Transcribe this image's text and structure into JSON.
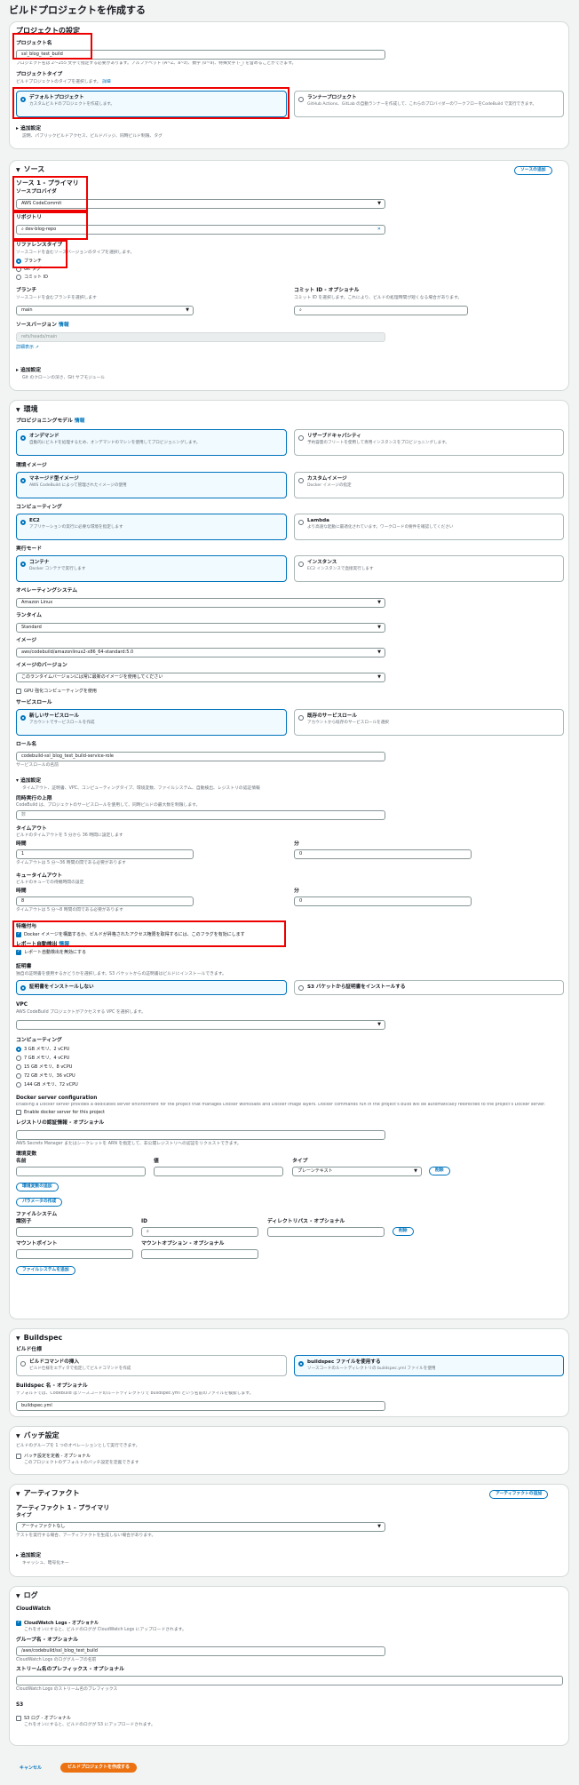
{
  "title": "ビルドプロジェクトを作成する",
  "config": {
    "heading": "プロジェクトの設定",
    "name_label": "プロジェクト名",
    "name_value": "ssl_blog_test_build",
    "name_desc": "プロジェクト名は 2～255 文字で指定する必要があります。アルファベット (A~Z、a~z)、数字 (0~9)、特殊文字 (-_) を含めることができます。",
    "type_label": "プロジェクトタイプ",
    "type_desc": "ビルドプロジェクトのタイプを選択します。",
    "type_more": "詳細",
    "tile1_t": "デフォルトプロジェクト",
    "tile1_d": "カスタムビルドのプロジェクトを作成します。",
    "tile2_t": "ランナープロジェクト",
    "tile2_d": "GitHub Actions、GitLab の自動ランナーを作成して、これらのプロバイダーのワークフローをCodeBuild で実行できます。",
    "additional": "追加設定",
    "additional_desc": "説明、パブリックビルドアクセス、ビルドバッジ、同時ビルド制限、タグ"
  },
  "source": {
    "heading": "ソース",
    "add_btn": "ソースの追加",
    "sub": "ソース 1 - プライマリ",
    "provider_label": "ソースプロバイダ",
    "provider": "AWS CodeCommit",
    "repo_label": "リポジトリ",
    "repo": "dev-blog-repo",
    "ref_label": "リファレンスタイプ",
    "ref_desc": "ソースコードを含むソースバージョンのタイプを選択します。",
    "opt1": "ブランチ",
    "opt2": "Git タグ",
    "opt3": "コミット ID",
    "branch_label": "ブランチ",
    "branch_desc": "ソースコードを含むブランチを選択します",
    "branch": "main",
    "commit_label": "コミット ID - オプショナル",
    "commit_desc": "コミット ID を選択します。これにより、ビルドの処理時間が短くなる場合があります。",
    "ver_label": "ソースバージョン",
    "ver_more": "情報",
    "ver_value": "refs/heads/main",
    "ver_link": "詳細表示 ↗",
    "more": "追加設定",
    "more_desc": "Git のクローンの深さ、Git サブモジュール"
  },
  "env": {
    "heading": "環境",
    "prov_label": "プロビジョニングモデル",
    "prov_more": "情報",
    "t_ondemand": "オンデマンド",
    "t_ondemand_d": "自動的にビルドを処理するため、オンデマンドのマシンを使用してプロビジョニングします。",
    "t_fleet": "リザーブドキャパシティ",
    "t_fleet_d": "予約容量のフリートを使用して専用インスタンスをプロビジョニングします。",
    "img_label": "環境イメージ",
    "t_managed": "マネージド型イメージ",
    "t_managed_d": "AWS CodeBuild によって管理されたイメージの使用",
    "t_custom": "カスタムイメージ",
    "t_custom_d": "Docker イメージの指定",
    "comp_label": "コンピューティング",
    "t_ec2": "EC2",
    "t_ec2_d": "アプリケーションの実行に必要な環境を指定します",
    "t_lambda": "Lambda",
    "t_lambda_d": "より高速な起動に最適化されています。ワークロードの要件を確認してください",
    "run_label": "実行モード",
    "t_container": "コンテナ",
    "t_container_d": "Docker コンテナで実行します",
    "t_instance": "インスタンス",
    "t_instance_d": "EC2 インスタンスで直接実行します",
    "os_label": "オペレーティングシステム",
    "os": "Amazon Linux",
    "rt_label": "ランタイム",
    "rt": "Standard",
    "image_label": "イメージ",
    "image": "aws/codebuild/amazonlinux2-x86_64-standard:5.0",
    "imgver_label": "イメージのバージョン",
    "imgver": "このランタイムバージョンには常に最新のイメージを使用してください",
    "gpu": "GPU 強化コンピューティングを使用",
    "role_label": "サービスロール",
    "t_newrole": "新しいサービスロール",
    "t_newrole_d": "アカウントでサービスロールを作成",
    "t_existrole": "既存のサービスロール",
    "t_existrole_d": "アカウントから既存のサービスロールを選択",
    "rolename_label": "ロール名",
    "rolename": "codebuild-ssl_blog_test_build-service-role",
    "rolename_desc": "サービスロールの名前",
    "more": "追加設定",
    "more_desc": "タイムアウト、証明書、VPC、コンピューティングタイプ、環境変数、ファイルシステム、自動検出、レジストリの認証情報",
    "conc_label": "同時実行の上限",
    "conc_desc": "CodeBuild は、プロジェクトのサービスロールを使用して、同時ビルドの最大数を制限します。",
    "conc_hint": "数",
    "timeout_label": "タイムアウト",
    "timeout_desc": "ビルドのタイムアウトを 5 分から 36 時間に設定します",
    "hours": "時間",
    "mins": "分",
    "hours_val": "1",
    "mins_val": "0",
    "timeout_hint": "タイムアウトは 5 分～36 時間の間である必要があります",
    "queue_label": "キュータイムアウト",
    "queue_desc": "ビルドのキューでの待機時間の設定",
    "queue_hours": "8",
    "queue_mins": "0",
    "queue_hint": "タイムアウトは 5 分～8 時間の間である必要があります",
    "priv_label": "特権付与",
    "priv_text": "Docker イメージを構築するか、ビルドが昇格されたアクセス権限を取得するには、このフラグを有効にします",
    "report_label": "レポート自動検出",
    "report_more": "情報",
    "report_text": "レポート自動検出を無効にする",
    "cert_label": "証明書",
    "cert_desc": "独自の証明書を使用するかどうかを選択します。S3 バケットからの証明書はビルドにインストールできます。",
    "t_nocert": "証明書をインストールしない",
    "t_s3cert": "S3 バケットから証明書をインストールする",
    "vpc_label": "VPC",
    "vpc_desc": "AWS CodeBuild プロジェクトがアクセスする VPC を選択します。",
    "comp2_label": "コンピューティング",
    "c1": "3 GB メモリ、2 vCPU",
    "c2": "7 GB メモリ、4 vCPU",
    "c3": "15 GB メモリ、8 vCPU",
    "c4": "72 GB メモリ、36 vCPU",
    "c5": "144 GB メモリ、72 vCPU",
    "docker_label": "Docker server configuration",
    "docker_desc": "Enabling a Docker server provides a dedicated server environment for the project that manages Docker workloads and Docker image layers. Docker commands run in the project's build will be automatically redirected to the project's Docker server.",
    "docker_chk": "Enable docker server for this project",
    "reg_label": "レジストリの認証情報 - オプショナル",
    "reg_desc": "AWS Secrets Manager またはシークレットを ARN を指定して、非公開レジストリへの認証をリクエストできます。",
    "envvars": "環境変数",
    "ev_name": "名前",
    "ev_value": "値",
    "ev_type": "タイプ",
    "ev_type_val": "プレーンテキスト",
    "ev_remove": "削除",
    "ev_add": "環境変数の追加",
    "param_btn": "パラメータの作成",
    "fs_label": "ファイルシステム",
    "fs_id": "識別子",
    "fs_idlbl": "ID",
    "fs_dir": "ディレクトリパス - オプショナル",
    "fs_remove": "削除",
    "fs_mount": "マウントポイント",
    "fs_opts": "マウントオプション - オプショナル",
    "fs_add": "ファイルシステムを追加"
  },
  "buildspec": {
    "heading": "Buildspec",
    "spec_label": "ビルド仕様",
    "t_insert": "ビルドコマンドの挿入",
    "t_insert_d": "ビルド仕様をエディタで指定してビルドコマンドを作成",
    "t_file": "buildspec ファイルを使用する",
    "t_file_d": "ソースコードのルートディレクトリの buildspec.yml ファイルを使用",
    "name_label": "Buildspec 名 - オプショナル",
    "name_desc": "デフォルトでは、CodeBuild はソースコードのルートディレクトリで buildspec.yml という名前のファイルを検索します。",
    "name_val": "buildspec.yml"
  },
  "batch": {
    "heading": "バッチ設定",
    "desc": "ビルドのグループを 1 つのオペレーションとして実行できます。",
    "chk": "バッチ設定を定義 - オプショナル",
    "chk_desc": "このプロジェクトのデフォルトのバッチ設定を定義できます"
  },
  "artifacts": {
    "heading": "アーティファクト",
    "add_btn": "アーティファクトの追加",
    "sub": "アーティファクト 1 - プライマリ",
    "type_label": "タイプ",
    "type": "アーティファクトなし",
    "type_desc": "テストを実行する場合、アーティファクトを生成しない場合があります。",
    "more": "追加設定",
    "more_desc": "キャッシュ、暗号化キー"
  },
  "logs": {
    "heading": "ログ",
    "cw": "CloudWatch",
    "cw_chk": "CloudWatch Logs - オプショナル",
    "cw_desc": "これをオンにすると、ビルドのログが CloudWatch Logs にアップロードされます。",
    "group_label": "グループ名 - オプショナル",
    "group_val": "/aws/codebuild/ssl_blog_test_build",
    "group_desc": "CloudWatch Logs のロググループの名前",
    "stream_label": "ストリーム名のプレフィックス - オプショナル",
    "stream_desc": "CloudWatch Logs のストリーム名のプレフィックス",
    "s3": "S3",
    "s3_chk": "S3 ログ - オプショナル",
    "s3_desc": "これをオンにすると、ビルドのログが S3 にアップロードされます。"
  },
  "footer": {
    "cancel": "キャンセル",
    "create": "ビルドプロジェクトを作成する"
  }
}
